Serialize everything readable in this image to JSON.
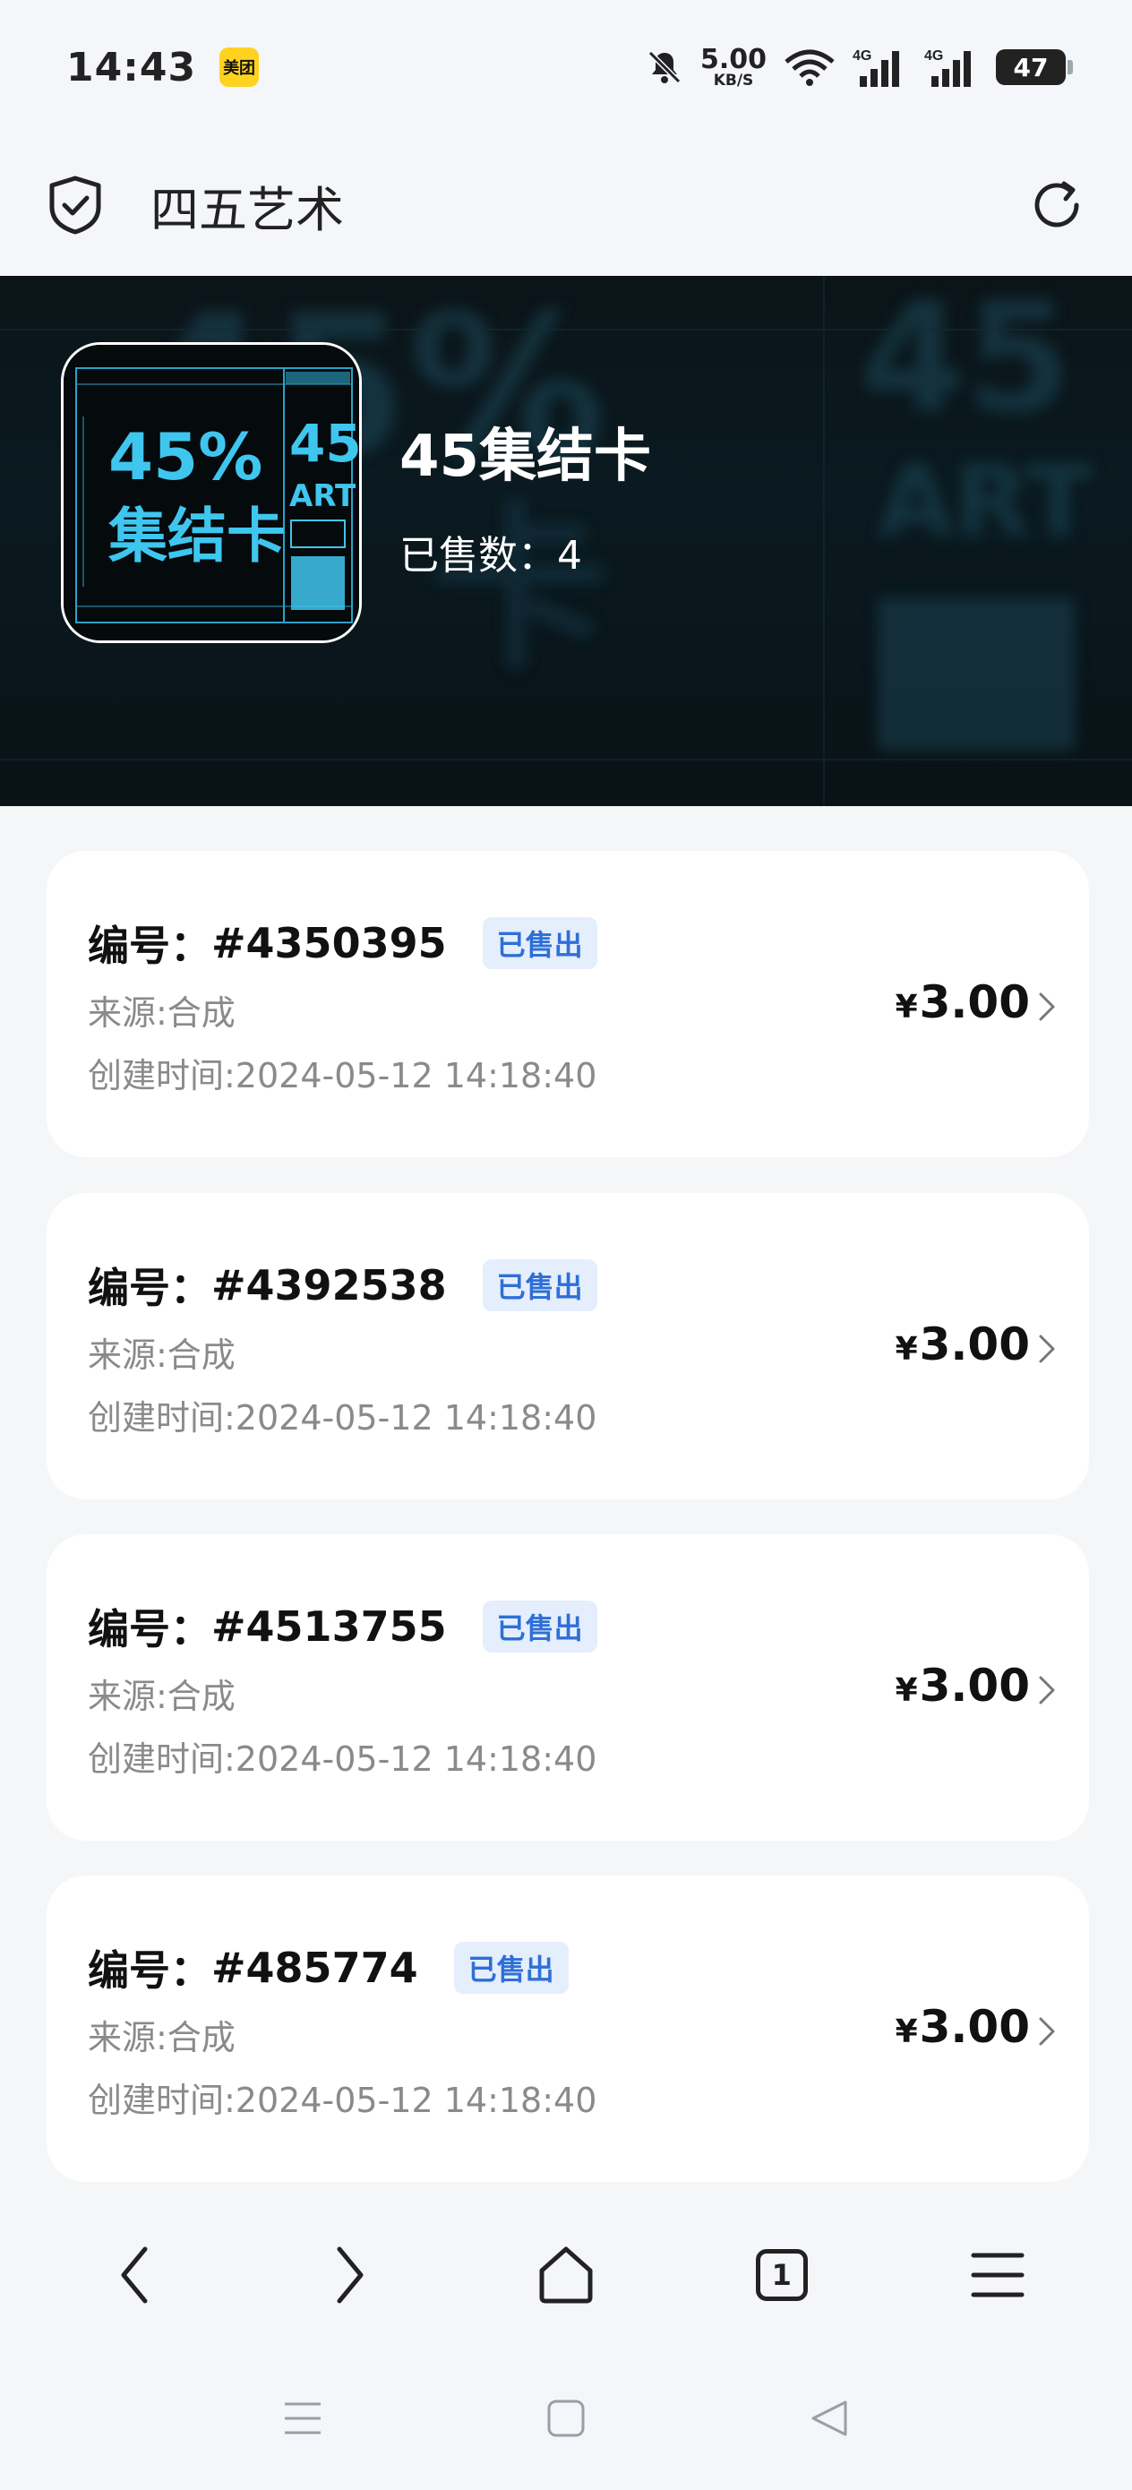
{
  "status_bar": {
    "time": "14:43",
    "app_badge": "美团",
    "net_speed": "5.00",
    "net_unit": "KB/S",
    "signal_1": "4G",
    "signal_2": "4G",
    "battery": "47",
    "icons": [
      "mute-icon",
      "wifi-icon",
      "signal-icon",
      "signal-icon",
      "battery-icon"
    ]
  },
  "title_bar": {
    "title": "四五艺术",
    "icons": [
      "shield-check-icon",
      "reload-icon"
    ]
  },
  "hero": {
    "collection_name": "45集结卡",
    "sold_label": "已售数：",
    "sold_count": "4",
    "thumb": {
      "big_text_1": "45%",
      "big_text_2": "集结卡",
      "side_text_1": "45",
      "side_text_2": "ART"
    }
  },
  "items": [
    {
      "id_label": "编号：",
      "id": "#4350395",
      "badge": "已售出",
      "source": "来源:合成",
      "created": "创建时间:2024-05-12 14:18:40",
      "price": "3.00",
      "currency": "¥"
    },
    {
      "id_label": "编号：",
      "id": "#4392538",
      "badge": "已售出",
      "source": "来源:合成",
      "created": "创建时间:2024-05-12 14:18:40",
      "price": "3.00",
      "currency": "¥"
    },
    {
      "id_label": "编号：",
      "id": "#4513755",
      "badge": "已售出",
      "source": "来源:合成",
      "created": "创建时间:2024-05-12 14:18:40",
      "price": "3.00",
      "currency": "¥"
    },
    {
      "id_label": "编号：",
      "id": "#485774",
      "badge": "已售出",
      "source": "来源:合成",
      "created": "创建时间:2024-05-12 14:18:40",
      "price": "3.00",
      "currency": "¥"
    }
  ],
  "bottom_nav": {
    "tab_count": "1",
    "icons": [
      "back-icon",
      "forward-icon",
      "home-icon",
      "tabs-icon",
      "menu-icon"
    ]
  },
  "system_nav": {
    "icons": [
      "recents-icon",
      "home-square-icon",
      "back-triangle-icon"
    ]
  },
  "colors": {
    "accent_badge_bg": "#e4eefc",
    "accent_badge_text": "#2f6fd6",
    "hero_cyan": "#3fc6ee",
    "page_bg": "#f5f6f8"
  }
}
